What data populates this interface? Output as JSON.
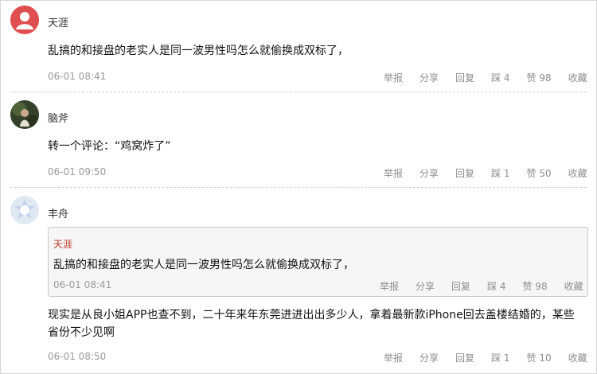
{
  "comments": [
    {
      "user": "天涯",
      "avatar_icon": "default-user-icon",
      "avatar_color": "#e04f4f",
      "content": "乱搞的和接盘的老实人是同一波男性吗怎么就偷换成双标了，",
      "time": "06-01 08:41",
      "report": "举报",
      "share": "分享",
      "reply": "回复",
      "dislike": "踩 4",
      "like": "赞 98",
      "favorite": "收藏"
    },
    {
      "user": "脑斧",
      "avatar_icon": "photo-avatar-icon",
      "content": "转一个评论：“鸡窝炸了”",
      "time": "06-01 09:50",
      "report": "举报",
      "share": "分享",
      "reply": "回复",
      "dislike": "踩 1",
      "like": "赞 50",
      "favorite": "收藏"
    },
    {
      "user": "丰舟",
      "avatar_icon": "star-badge-icon",
      "avatar_color": "#c7d6ea",
      "quote": {
        "user": "天涯",
        "content": "乱搞的和接盘的老实人是同一波男性吗怎么就偷换成双标了，",
        "time": "06-01 08:41",
        "report": "举报",
        "share": "分享",
        "reply": "回复",
        "dislike": "踩 4",
        "like": "赞 98",
        "favorite": "收藏"
      },
      "content_line1": "现实是从良小姐APP也查不到，二十年来年东莞进进出出多少人，拿着最新款iPhone回去盖楼结婚的，某些",
      "content_line2": "省份不少见啊",
      "time": "06-01 08:50",
      "report": "举报",
      "share": "分享",
      "reply": "回复",
      "dislike": "踩 1",
      "like": "赞 10",
      "favorite": "收藏"
    }
  ]
}
